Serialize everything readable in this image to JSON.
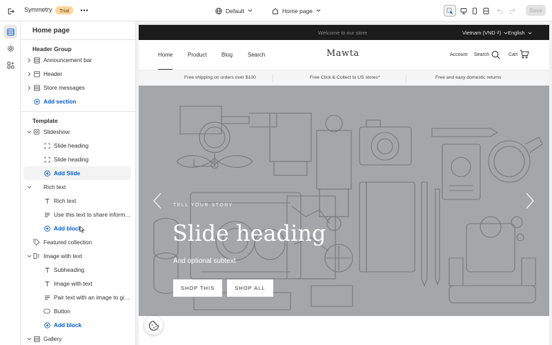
{
  "topbar": {
    "app_title": "Symmetry",
    "badge": "Trial",
    "theme_selector": "Default",
    "page_selector": "Home page",
    "save_label": "Save"
  },
  "sidebar": {
    "title": "Home page",
    "header_group": {
      "label": "Header Group",
      "items": [
        {
          "label": "Announcement bar",
          "icon": "section-icon"
        },
        {
          "label": "Header",
          "icon": "section-icon"
        },
        {
          "label": "Store messages",
          "icon": "section-icon"
        }
      ],
      "add_label": "Add section"
    },
    "template": {
      "label": "Template",
      "slideshow": {
        "label": "Slideshow",
        "blocks": [
          "Slide heading",
          "Slide heading"
        ],
        "add_label": "Add Slide"
      },
      "rich_text": {
        "label": "Rich text",
        "blocks": [
          "Rich text",
          "Use this text to share informat..."
        ],
        "add_label": "Add block"
      },
      "featured_collection": {
        "label": "Featured collection"
      },
      "image_with_text": {
        "label": "Image with text",
        "blocks": [
          "Subheading",
          "Image with text",
          "Pair text with an image to give...",
          "Button"
        ],
        "add_label": "Add block"
      },
      "gallery": {
        "label": "Gallery"
      }
    }
  },
  "preview": {
    "announcement": "Welcome to our store",
    "currency": "Vietnam (VND ₫)",
    "language": "English",
    "nav": [
      "Home",
      "Product",
      "Blog",
      "Search"
    ],
    "logo": "Mawta",
    "account": "Account",
    "search": "Search",
    "cart": "Cart",
    "messages": [
      "Free shipping on orders over $100",
      "Free Click & Collect to US stores*",
      "Free and easy domestic returns"
    ],
    "hero": {
      "eyebrow": "TELL YOUR STORY",
      "heading": "Slide heading",
      "subtext": "And optional subtext",
      "buttons": [
        "SHOP THIS",
        "SHOP ALL"
      ]
    }
  },
  "colors": {
    "accent_blue": "#005bd3",
    "badge_bg": "#ffd79d",
    "hero_bg": "#a4a6a9",
    "announcement_bg": "#1c1c1c"
  }
}
